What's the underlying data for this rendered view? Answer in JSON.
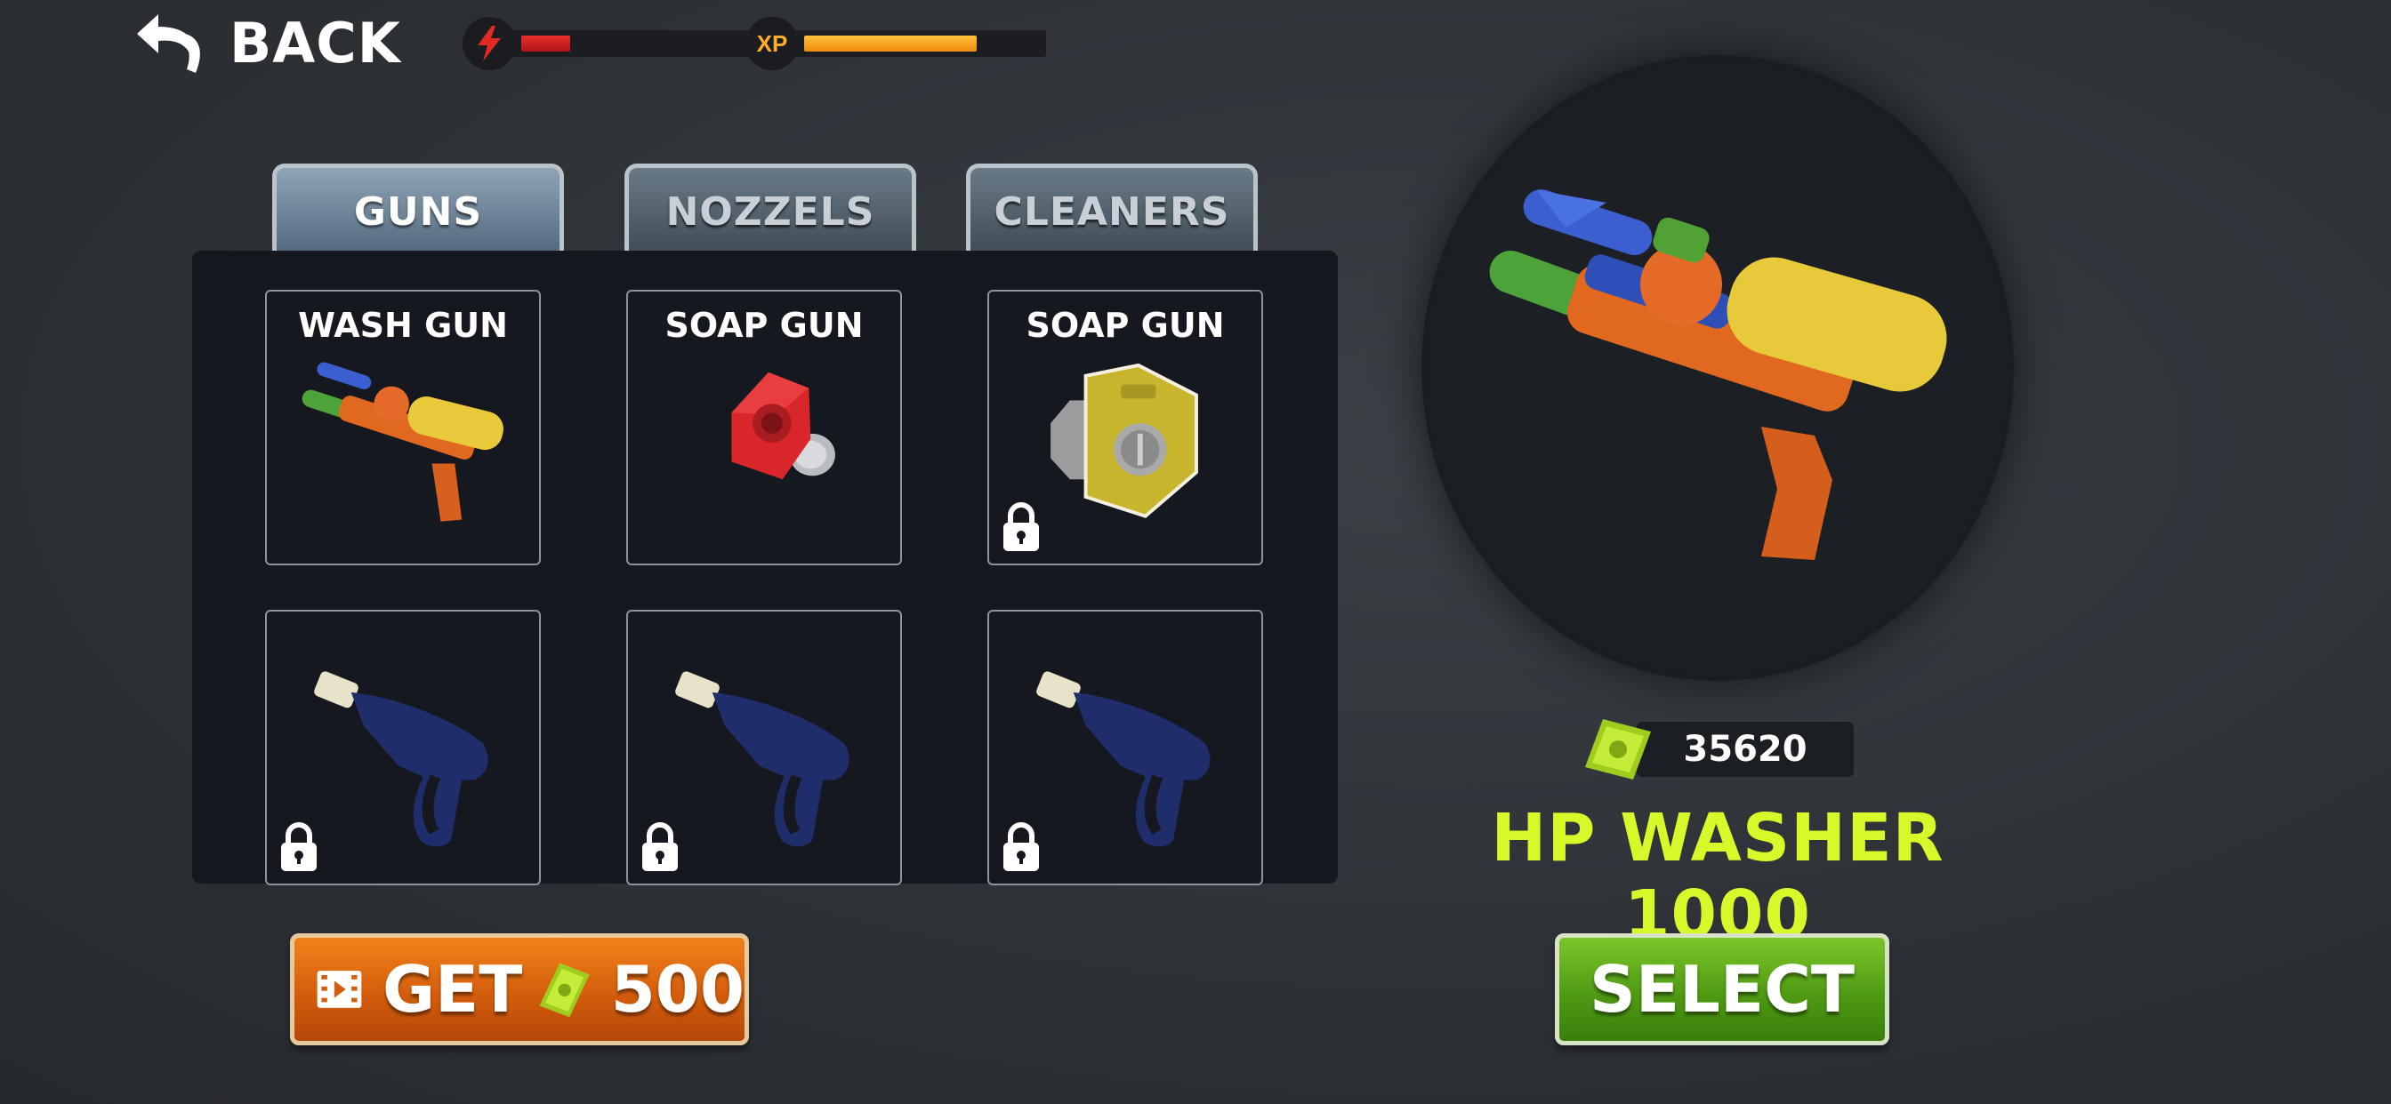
{
  "header": {
    "back_label": "BACK",
    "energy": {
      "icon": "lightning-bolt-icon",
      "level": 0.22,
      "color": "#e02a26"
    },
    "xp": {
      "badge_text": "XP",
      "level": 0.77,
      "color": "#ffab23"
    }
  },
  "tabs": [
    {
      "label": "GUNS",
      "active": true
    },
    {
      "label": "NOZZELS",
      "active": false
    },
    {
      "label": "CLEANERS",
      "active": false
    }
  ],
  "items": [
    {
      "title": "WASH GUN",
      "icon": "water-gun-icon",
      "locked": false
    },
    {
      "title": "SOAP GUN",
      "icon": "red-nozzle-icon",
      "locked": false
    },
    {
      "title": "SOAP GUN",
      "icon": "yellow-nozzle-icon",
      "locked": true
    },
    {
      "title": "",
      "icon": "pressure-washer-gun-icon",
      "locked": true
    },
    {
      "title": "",
      "icon": "pressure-washer-gun-icon",
      "locked": true
    },
    {
      "title": "",
      "icon": "pressure-washer-gun-icon",
      "locked": true
    }
  ],
  "preview": {
    "icon": "water-gun-icon",
    "price": "35620",
    "name": "HP WASHER 1000"
  },
  "buttons": {
    "get_label": "GET",
    "get_amount": "500",
    "select_label": "SELECT"
  },
  "colors": {
    "name_accent": "#d6f92a",
    "get_button": "#e06a12",
    "select_button": "#5aa81a"
  }
}
